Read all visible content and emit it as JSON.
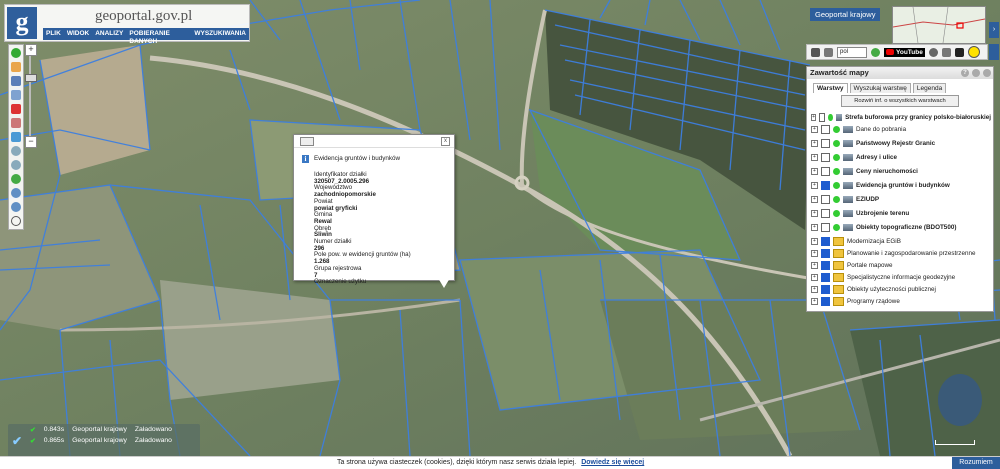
{
  "header": {
    "logo": "g",
    "site_name": "geoportal.gov.pl",
    "menu": [
      "PLIK",
      "WIDOK",
      "ANALIZY",
      "POBIERANIE DANYCH",
      "WYSZUKIWANIA"
    ]
  },
  "top_right": {
    "minimap_label": "Geoportal krajowy",
    "language": "pol",
    "youtube_label": "YouTube"
  },
  "layers_panel": {
    "title": "Zawartość mapy",
    "help": "?",
    "tabs": [
      "Warstwy",
      "Wyszukaj warstwę",
      "Legenda"
    ],
    "expand_button": "Rozwiń inf. o wszystkich warstwach",
    "layers": [
      {
        "name": "Strefa buforowa przy granicy polsko-białoruskiej",
        "checked": false,
        "bold": true,
        "kind": "layer"
      },
      {
        "name": "Dane do pobrania",
        "checked": false,
        "bold": false,
        "kind": "layer"
      },
      {
        "name": "Państwowy Rejestr Granic",
        "checked": false,
        "bold": true,
        "kind": "layer"
      },
      {
        "name": "Adresy i ulice",
        "checked": false,
        "bold": true,
        "kind": "layer"
      },
      {
        "name": "Ceny nieruchomości",
        "checked": false,
        "bold": true,
        "kind": "layer"
      },
      {
        "name": "Ewidencja gruntów i budynków",
        "checked": true,
        "bold": true,
        "kind": "layer"
      },
      {
        "name": "EZIUDP",
        "checked": false,
        "bold": true,
        "kind": "layer"
      },
      {
        "name": "Uzbrojenie terenu",
        "checked": false,
        "bold": true,
        "kind": "layer"
      },
      {
        "name": "Obiekty topograficzne (BDOT500)",
        "checked": false,
        "bold": true,
        "kind": "layer"
      },
      {
        "name": "Modernizacja EGiB",
        "checked": true,
        "bold": false,
        "kind": "folder"
      },
      {
        "name": "Planowanie i zagospodarowanie przestrzenne",
        "checked": true,
        "bold": false,
        "kind": "folder"
      },
      {
        "name": "Portale mapowe",
        "checked": true,
        "bold": false,
        "kind": "folder"
      },
      {
        "name": "Specjalistyczne informacje geodezyjne",
        "checked": true,
        "bold": false,
        "kind": "folder"
      },
      {
        "name": "Obiekty użyteczności publicznej",
        "checked": true,
        "bold": false,
        "kind": "folder"
      },
      {
        "name": "Programy rządowe",
        "checked": true,
        "bold": false,
        "kind": "folder"
      }
    ]
  },
  "popup": {
    "title": "Ewidencja gruntów i budynków",
    "close": "x",
    "fields": [
      {
        "label": "Identyfikator działki",
        "value": "320507_2.0005.296"
      },
      {
        "label": "Województwo",
        "value": "zachodniopomorskie"
      },
      {
        "label": "Powiat",
        "value": "powiat gryficki"
      },
      {
        "label": "Gmina",
        "value": "Rewal"
      },
      {
        "label": "Obręb",
        "value": "Śliwin"
      },
      {
        "label": "Numer działki",
        "value": "296"
      },
      {
        "label": "Pole pow. w ewidencji gruntów (ha)",
        "value": "1.268"
      },
      {
        "label": "Grupa rejestrowa",
        "value": "7"
      },
      {
        "label": "Oznaczenie użytku",
        "value": ""
      }
    ]
  },
  "status": [
    {
      "time": "0.843s",
      "service": "Geoportal krajowy",
      "state": "Załadowano"
    },
    {
      "time": "0.865s",
      "service": "Geoportal krajowy",
      "state": "Załadowano"
    }
  ],
  "cookie": {
    "text": "Ta strona używa ciasteczek (cookies), dzięki którym nasz serwis działa lepiej.",
    "link": "Dowiedz się więcej",
    "button": "Rozumiem"
  },
  "colors": {
    "brand": "#2d5e9c",
    "parcel_line": "#3d7fe0",
    "checked": "#1e5ccf"
  }
}
